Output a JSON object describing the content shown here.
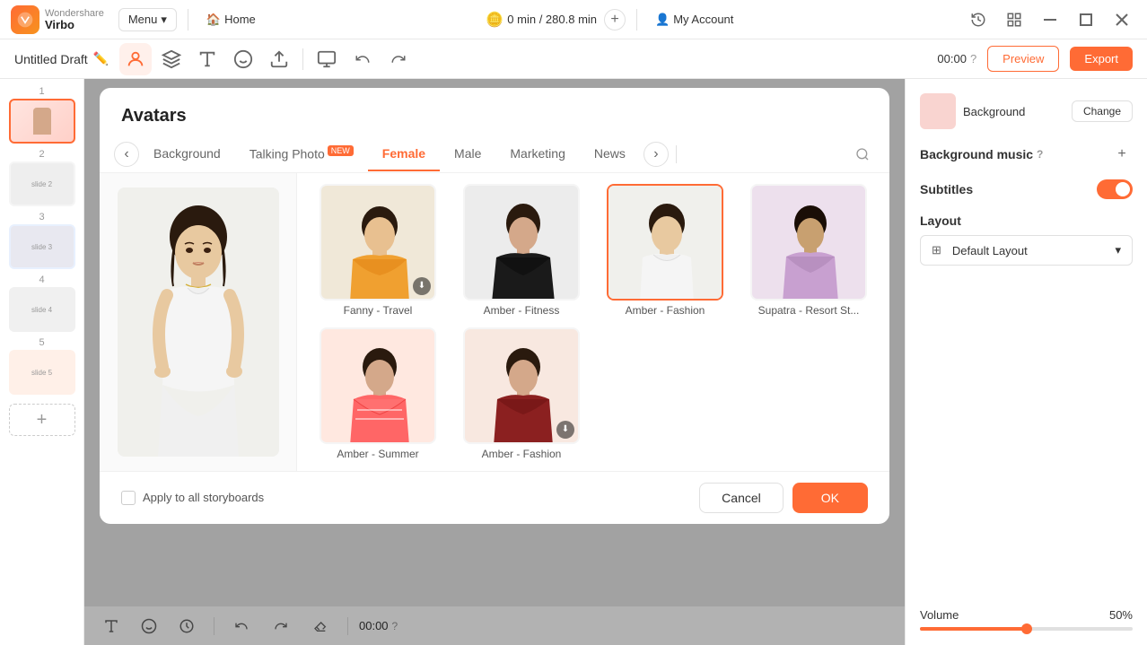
{
  "app": {
    "logo_name": "Wondershare",
    "logo_sub": "Virbo",
    "menu_label": "Menu",
    "home_label": "Home",
    "time_label": "0 min / 280.8 min",
    "my_account_label": "My Account",
    "preview_label": "Preview",
    "export_label": "Export"
  },
  "editor": {
    "draft_title": "Untitled Draft",
    "timecode": "00:00",
    "help_icon": "?"
  },
  "modal": {
    "title": "Avatars",
    "tabs": [
      {
        "id": "background",
        "label": "Background",
        "active": false,
        "new": false
      },
      {
        "id": "talking-photo",
        "label": "Talking Photo",
        "active": false,
        "new": true
      },
      {
        "id": "female",
        "label": "Female",
        "active": true,
        "new": false
      },
      {
        "id": "male",
        "label": "Male",
        "active": false,
        "new": false
      },
      {
        "id": "marketing",
        "label": "Marketing",
        "active": false,
        "new": false
      },
      {
        "id": "news",
        "label": "News",
        "active": false,
        "new": false
      }
    ],
    "avatars": [
      {
        "id": 1,
        "name": "Fanny - Travel",
        "selected": false,
        "has_download": true,
        "color": "#f5e6c8",
        "skin": "#e8c9a0",
        "top": "#f0a040"
      },
      {
        "id": 2,
        "name": "Amber - Fitness",
        "selected": false,
        "has_download": false,
        "color": "#e8e8e8",
        "skin": "#d4a88a",
        "top": "#222"
      },
      {
        "id": 3,
        "name": "Amber - Fashion",
        "selected": true,
        "has_download": false,
        "color": "#f0f0f0",
        "skin": "#d4a88a",
        "top": "#f0f0f0"
      },
      {
        "id": 4,
        "name": "Supatra - Resort St...",
        "selected": false,
        "has_download": false,
        "color": "#e8d8e8",
        "skin": "#c8a070",
        "top": "#c8a0d0"
      },
      {
        "id": 5,
        "name": "Amber - Summer",
        "selected": false,
        "has_download": false,
        "color": "#ffe0d8",
        "skin": "#d4a88a",
        "top": "#ff6060"
      },
      {
        "id": 6,
        "name": "Amber - Fashion",
        "selected": false,
        "has_download": true,
        "color": "#f8e8e0",
        "skin": "#d4a88a",
        "top": "#8b2020"
      }
    ],
    "apply_label": "Apply to all storyboards",
    "cancel_label": "Cancel",
    "ok_label": "OK"
  },
  "right_panel": {
    "background_label": "Background",
    "change_label": "Change",
    "bg_music_label": "Background music",
    "subtitles_label": "Subtitles",
    "layout_label": "Layout",
    "default_layout_label": "Default Layout",
    "volume_label": "Volume",
    "volume_value": "50%",
    "volume_percent": 50
  },
  "slides": [
    {
      "num": "1",
      "active": true
    },
    {
      "num": "2",
      "active": false
    },
    {
      "num": "3",
      "active": false
    },
    {
      "num": "4",
      "active": false
    },
    {
      "num": "5",
      "active": false
    }
  ],
  "bottom_bar": {
    "timecode": "00:00"
  }
}
